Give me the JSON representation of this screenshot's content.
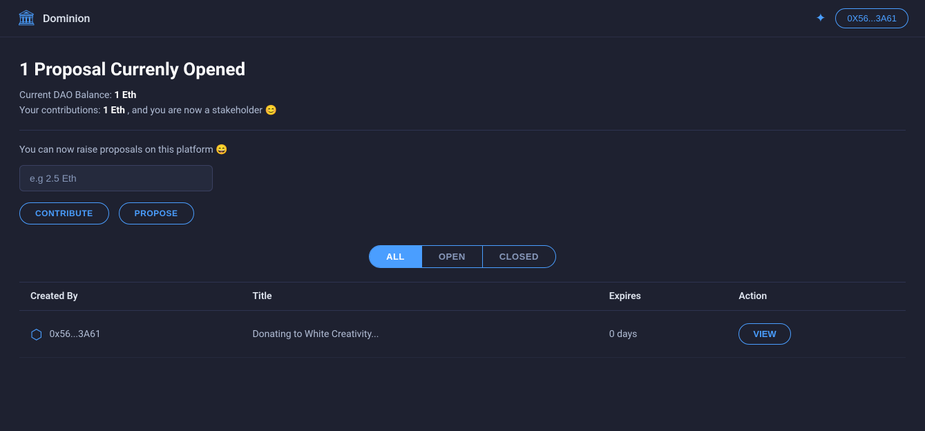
{
  "header": {
    "app_title": "Dominion",
    "wallet_address": "0X56...3A61",
    "logo_icon": "🏛",
    "sun_icon": "✦"
  },
  "main": {
    "page_title": "1 Proposal Currenly Opened",
    "balance_label": "Current DAO Balance:",
    "balance_value": "1 Eth",
    "contributions_label": "Your contributions:",
    "contributions_value": "1 Eth",
    "contributions_suffix": ", and you are now a stakeholder 😊",
    "raise_text": "You can now raise proposals on this platform 😄",
    "eth_input_placeholder": "e.g 2.5 Eth",
    "contribute_button": "CONTRIBUTE",
    "propose_button": "PROPOSE"
  },
  "filters": {
    "tabs": [
      {
        "label": "ALL",
        "active": true
      },
      {
        "label": "OPEN",
        "active": false
      },
      {
        "label": "CLOSED",
        "active": false
      }
    ]
  },
  "table": {
    "headers": [
      "Created By",
      "Title",
      "Expires",
      "Action"
    ],
    "rows": [
      {
        "created_by": "0x56...3A61",
        "title": "Donating to White Creativity...",
        "expires": "0 days",
        "action": "VIEW"
      }
    ]
  }
}
